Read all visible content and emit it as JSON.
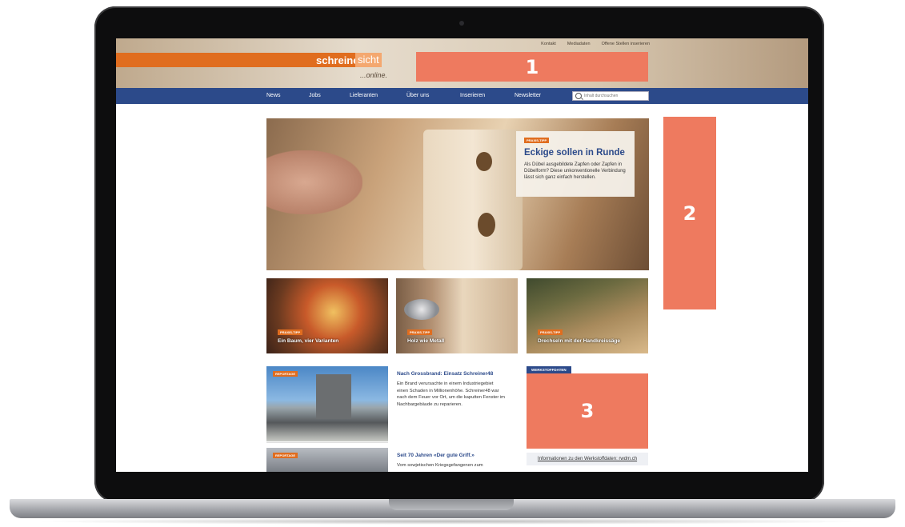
{
  "header": {
    "logo_main": "schreiner",
    "logo_accent": "sicht",
    "logo_suffix": "...online.",
    "top_links": [
      "Kontakt",
      "Mediadaten",
      "Offene Stellen inserieren"
    ]
  },
  "nav": {
    "items": [
      "News",
      "Jobs",
      "Lieferanten",
      "Über uns",
      "Inserieren",
      "Newsletter"
    ],
    "search_placeholder": "Inhalt durchsuchen"
  },
  "hero": {
    "badge": "PRAXIS-TIPP",
    "title": "Eckige sollen in Runde",
    "text": "Als Dübel ausgebildete Zapfen oder Zapfen in Dübelform? Diese unkonventionelle Verbindung lässt sich ganz einfach herstellen."
  },
  "tiles": [
    {
      "badge": "PRAXIS-TIPP",
      "title": "Ein Baum, vier Varianten"
    },
    {
      "badge": "PRAXIS-TIPP",
      "title": "Holz wie Metall"
    },
    {
      "badge": "PRAXIS-TIPP",
      "title": "Drechseln mit der Handkreissäge"
    }
  ],
  "articles": [
    {
      "badge": "REPORTAGE",
      "title": "Nach Grossbrand: Einsatz Schreiner48",
      "text": "Ein Brand verursachte in einem Industriegebiet einen Schaden in Millionenhöhe. Schreiner48 war nach dem Feuer vor Ort, um die kaputten Fenster im Nachbargebäude zu reparieren."
    },
    {
      "badge": "REPORTAGE",
      "title": "Seit 70 Jahren «Der gute Griff.»",
      "text": "Vom sowjetischen Kriegsgefangenen zum"
    }
  ],
  "ad": {
    "tag": "WERKSTOFFDATEN",
    "footer": "Informationen zu den Werkstoffdaten: rwdm.ch"
  },
  "callouts": [
    "1",
    "2",
    "3"
  ],
  "colors": {
    "brand_orange": "#e06d1f",
    "nav_blue": "#2c4a8a",
    "callout": "#ee7a5f"
  }
}
